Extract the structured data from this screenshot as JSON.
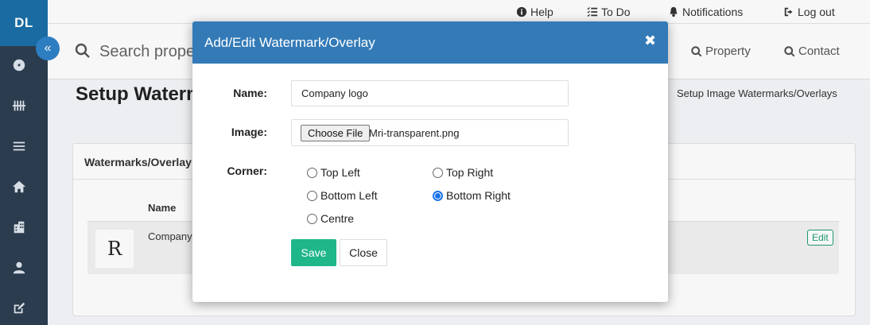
{
  "app": {
    "logo_text": "DL"
  },
  "sidebar": {
    "collapse_icon": "«",
    "items": [
      {
        "icon": "dashboard-icon"
      },
      {
        "icon": "tally-icon"
      },
      {
        "icon": "list-icon"
      },
      {
        "icon": "home-icon"
      },
      {
        "icon": "building-icon"
      },
      {
        "icon": "user-icon"
      },
      {
        "icon": "edit-icon"
      }
    ]
  },
  "topbar": {
    "help": "Help",
    "todo": "To Do",
    "notifications": "Notifications",
    "logout": "Log out"
  },
  "searchbar": {
    "placeholder": "Search proper",
    "property": "Property",
    "contact": "Contact"
  },
  "page": {
    "title": "Setup Waterm",
    "breadcrumb": "Setup Image Watermarks/Overlays"
  },
  "card": {
    "title": "Watermarks/Overlay",
    "column_name": "Name",
    "row": {
      "name": "Company",
      "thumb_text": "R",
      "edit_label": "Edit"
    }
  },
  "modal": {
    "title": "Add/Edit Watermark/Overlay",
    "close_icon": "✖",
    "name_label": "Name:",
    "name_value": "Company logo",
    "image_label": "Image:",
    "choose_file_label": "Choose File",
    "file_name": "Mri-transparent.png",
    "corner_label": "Corner:",
    "corners": [
      {
        "label": "Top Left",
        "checked": false
      },
      {
        "label": "Top Right",
        "checked": false
      },
      {
        "label": "Bottom Left",
        "checked": false
      },
      {
        "label": "Bottom Right",
        "checked": true
      },
      {
        "label": "Centre",
        "checked": false
      }
    ],
    "save_label": "Save",
    "close_label": "Close"
  },
  "colors": {
    "sidebar_bg": "#2c3e50",
    "logo_bg": "#1b6fa8",
    "modal_header": "#337ab7",
    "save_button": "#1fb68a",
    "radio_accent": "#1a73e8"
  }
}
